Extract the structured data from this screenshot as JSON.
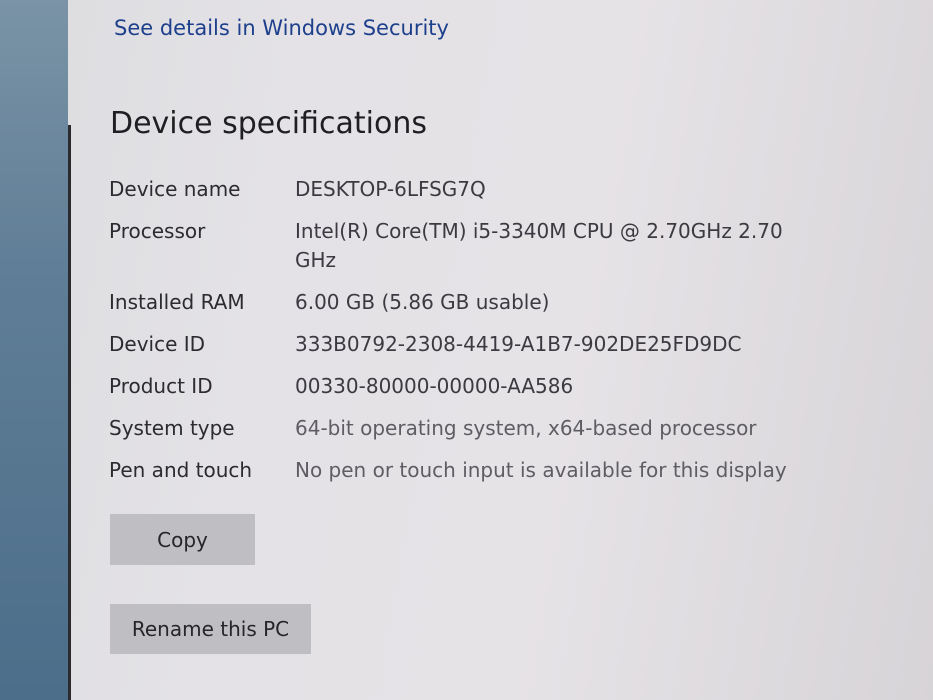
{
  "links": {
    "security": "See details in Windows Security"
  },
  "section": {
    "title": "Device specifications"
  },
  "specs": [
    {
      "label": "Device name",
      "value": "DESKTOP-6LFSG7Q"
    },
    {
      "label": "Processor",
      "value": "Intel(R) Core(TM) i5-3340M CPU @ 2.70GHz   2.70 GHz"
    },
    {
      "label": "Installed RAM",
      "value": "6.00 GB (5.86 GB usable)"
    },
    {
      "label": "Device ID",
      "value": "333B0792-2308-4419-A1B7-902DE25FD9DC"
    },
    {
      "label": "Product ID",
      "value": "00330-80000-00000-AA586"
    },
    {
      "label": "System type",
      "value": "64-bit operating system, x64-based processor"
    },
    {
      "label": "Pen and touch",
      "value": "No pen or touch input is available for this display"
    }
  ],
  "buttons": {
    "copy": "Copy",
    "rename": "Rename this PC"
  }
}
